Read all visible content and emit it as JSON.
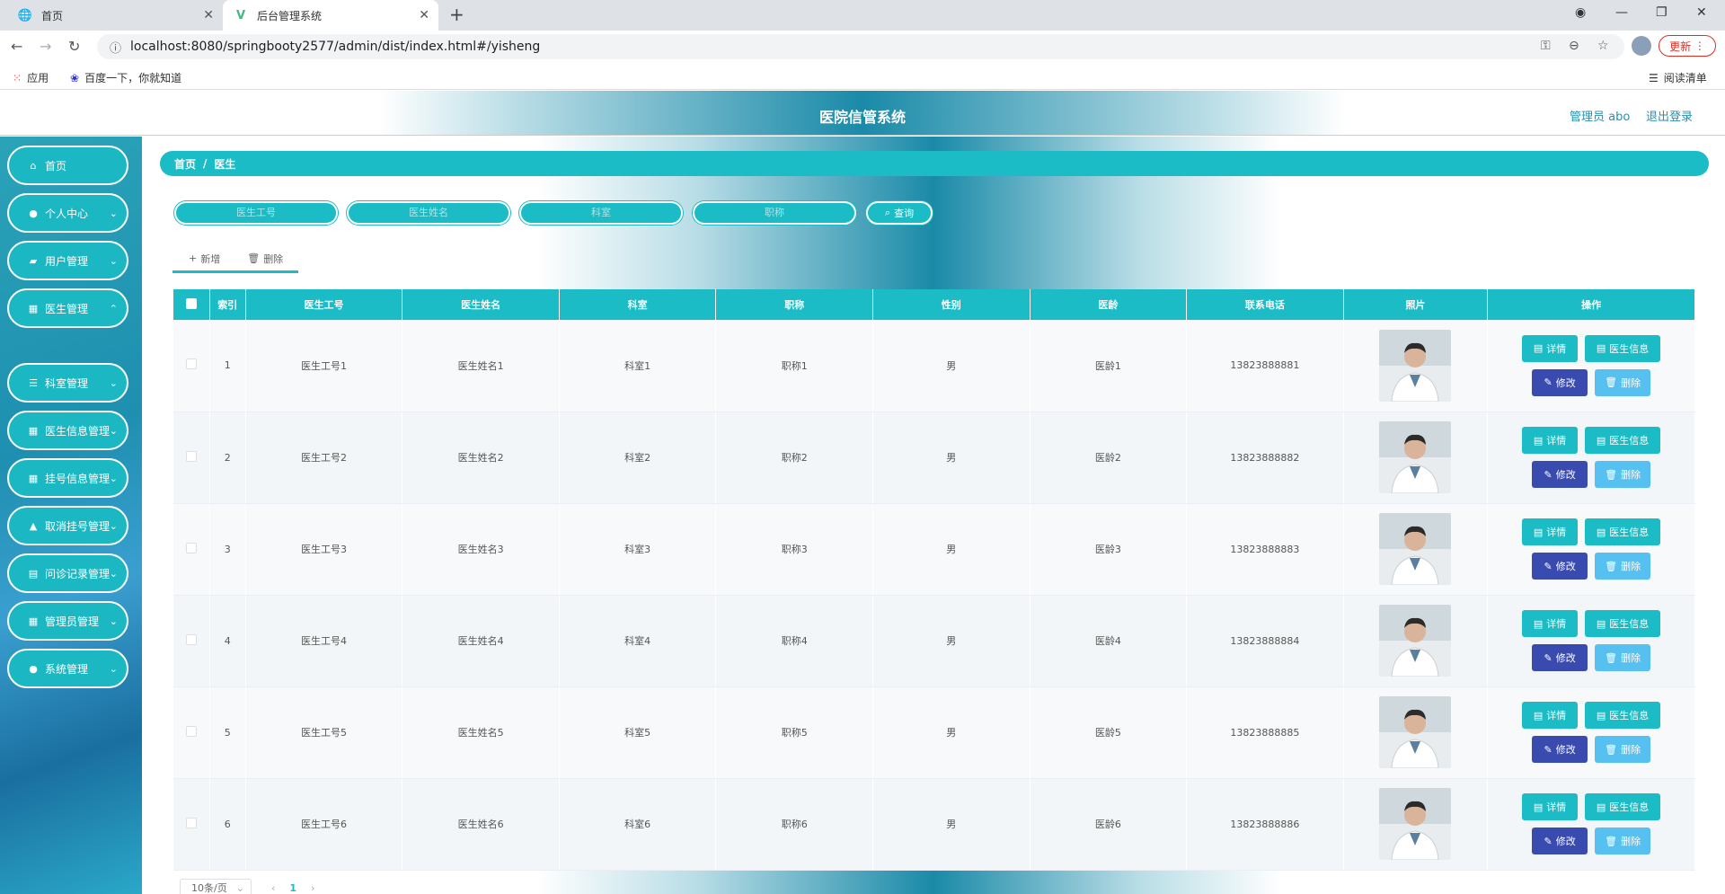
{
  "browser": {
    "tabs": [
      {
        "title": "首页",
        "icon": "globe-icon"
      },
      {
        "title": "后台管理系统",
        "icon": "vue-icon"
      }
    ],
    "url": "localhost:8080/springbooty2577/admin/dist/index.html#/yisheng",
    "update_label": "更新",
    "bookmarks": [
      {
        "label": "应用",
        "icon": "apps-grid-icon"
      },
      {
        "label": "百度一下，你就知道",
        "icon": "baidu-paw-icon"
      }
    ],
    "reading_list": "阅读清单"
  },
  "header": {
    "title": "医院信管系统",
    "user": "管理员 abo",
    "logout": "退出登录"
  },
  "sidebar": {
    "items": [
      {
        "label": "首页",
        "icon": "home-icon",
        "has_children": false
      },
      {
        "label": "个人中心",
        "icon": "user-icon",
        "has_children": true
      },
      {
        "label": "用户管理",
        "icon": "chat-icon",
        "has_children": true
      },
      {
        "label": "医生管理",
        "icon": "grid-icon",
        "has_children": true
      },
      {
        "label": "科室管理",
        "icon": "sliders-icon",
        "has_children": true
      },
      {
        "label": "医生信息管理",
        "icon": "grid-icon",
        "has_children": true
      },
      {
        "label": "挂号信息管理",
        "icon": "grid-icon",
        "has_children": true
      },
      {
        "label": "取消挂号管理",
        "icon": "thumbs-icon",
        "has_children": true
      },
      {
        "label": "问诊记录管理",
        "icon": "document-icon",
        "has_children": true
      },
      {
        "label": "管理员管理",
        "icon": "grid-icon",
        "has_children": true
      },
      {
        "label": "系统管理",
        "icon": "bulb-icon",
        "has_children": true
      }
    ],
    "active_sub": "医生"
  },
  "breadcrumb": {
    "home": "首页",
    "separator": "/",
    "current": "医生"
  },
  "search": {
    "placeholders": [
      "医生工号",
      "医生姓名",
      "科室",
      "职称"
    ],
    "button": "查询"
  },
  "actions": {
    "add": "新增",
    "delete": "删除"
  },
  "table": {
    "headers": [
      "索引",
      "医生工号",
      "医生姓名",
      "科室",
      "职称",
      "性别",
      "医龄",
      "联系电话",
      "照片",
      "操作"
    ],
    "rows": [
      {
        "index": "1",
        "id": "医生工号1",
        "name": "医生姓名1",
        "dept": "科室1",
        "title": "职称1",
        "gender": "男",
        "years": "医龄1",
        "phone": "13823888881"
      },
      {
        "index": "2",
        "id": "医生工号2",
        "name": "医生姓名2",
        "dept": "科室2",
        "title": "职称2",
        "gender": "男",
        "years": "医龄2",
        "phone": "13823888882"
      },
      {
        "index": "3",
        "id": "医生工号3",
        "name": "医生姓名3",
        "dept": "科室3",
        "title": "职称3",
        "gender": "男",
        "years": "医龄3",
        "phone": "13823888883"
      },
      {
        "index": "4",
        "id": "医生工号4",
        "name": "医生姓名4",
        "dept": "科室4",
        "title": "职称4",
        "gender": "男",
        "years": "医龄4",
        "phone": "13823888884"
      },
      {
        "index": "5",
        "id": "医生工号5",
        "name": "医生姓名5",
        "dept": "科室5",
        "title": "职称5",
        "gender": "男",
        "years": "医龄5",
        "phone": "13823888885"
      },
      {
        "index": "6",
        "id": "医生工号6",
        "name": "医生姓名6",
        "dept": "科室6",
        "title": "职称6",
        "gender": "男",
        "years": "医龄6",
        "phone": "13823888886"
      }
    ],
    "ops": {
      "detail": "详情",
      "info": "医生信息",
      "edit": "修改",
      "delete": "删除"
    }
  },
  "pager": {
    "size": "10条/页",
    "page": "1"
  },
  "colors": {
    "accent": "#1bbcc6",
    "edit": "#3a4bb0",
    "delete": "#56c0f0"
  }
}
